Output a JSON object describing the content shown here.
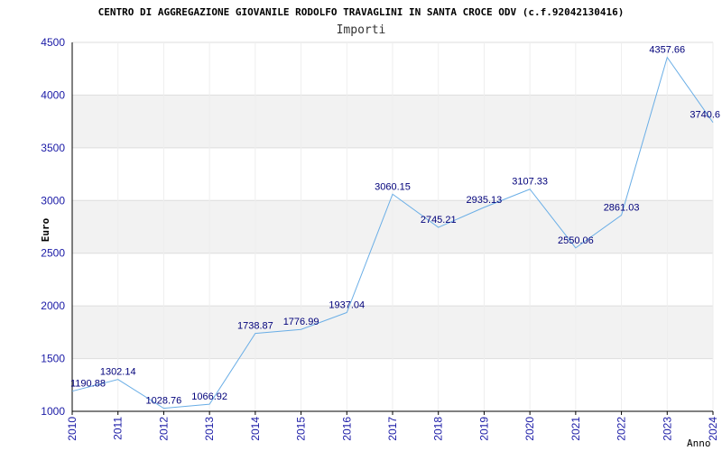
{
  "chart_data": {
    "type": "line",
    "title": "CENTRO DI AGGREGAZIONE GIOVANILE RODOLFO TRAVAGLINI IN SANTA CROCE ODV (c.f.92042130416)",
    "subtitle": "Importi",
    "xlabel": "Anno",
    "ylabel": "Euro",
    "categories": [
      "2010",
      "2011",
      "2012",
      "2013",
      "2014",
      "2015",
      "2016",
      "2017",
      "2018",
      "2019",
      "2020",
      "2021",
      "2022",
      "2023",
      "2024"
    ],
    "values": [
      1190.88,
      1302.14,
      1028.76,
      1066.92,
      1738.87,
      1776.99,
      1937.04,
      3060.15,
      2745.21,
      2935.13,
      3107.33,
      2550.06,
      2861.03,
      4357.66,
      3740.6
    ],
    "value_labels": [
      "1190.88",
      "1302.14",
      "1028.76",
      "1066.92",
      "1738.87",
      "1776.99",
      "1937.04",
      "3060.15",
      "2745.21",
      "2935.13",
      "3107.33",
      "2550.06",
      "2861.03",
      "4357.66",
      "3740.6"
    ],
    "ylim": [
      1000,
      4500
    ],
    "yticks": [
      "1000",
      "1500",
      "2000",
      "2500",
      "3000",
      "3500",
      "4000",
      "4500"
    ],
    "grid": true,
    "colors": {
      "line": "#6aaee6",
      "band": "#f2f2f2",
      "axis": "#000000",
      "grid": "#dddddd",
      "tick_text": "#1a1aa6",
      "label_text": "#00007a"
    }
  }
}
